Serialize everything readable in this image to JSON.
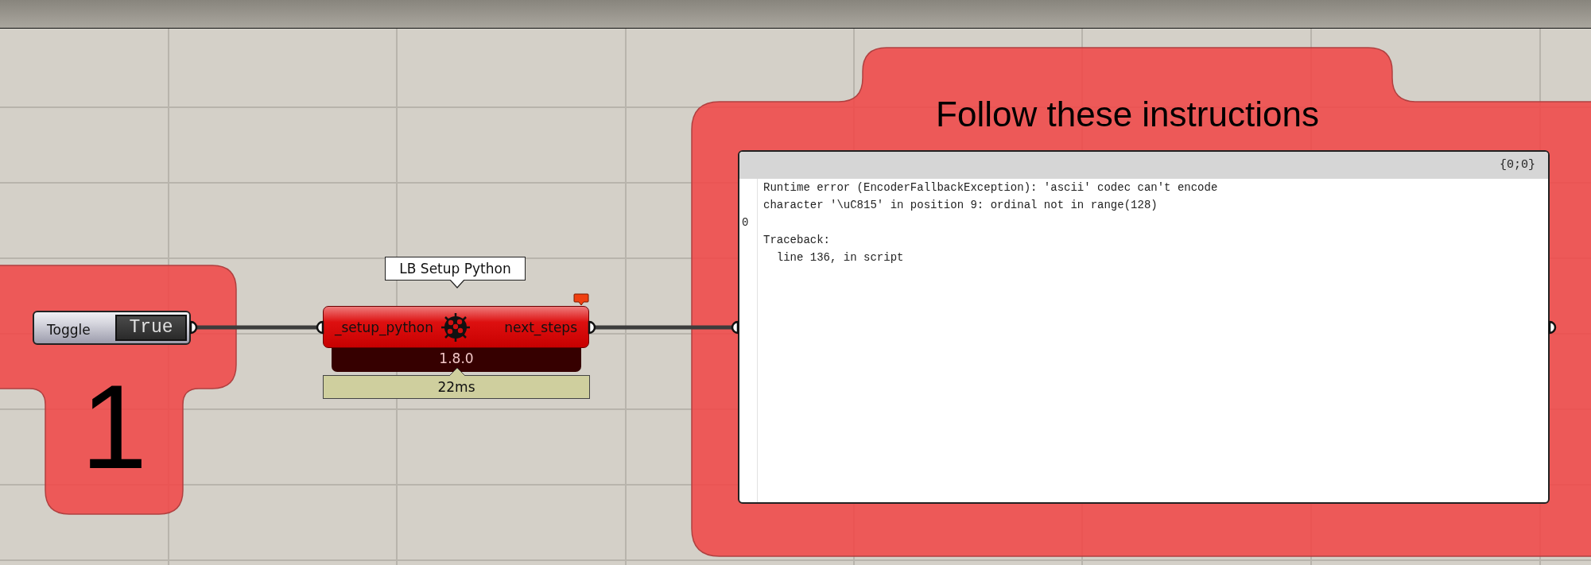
{
  "groups": [
    {
      "kind": "tee",
      "title": "1"
    },
    {
      "kind": "tab",
      "title": "Follow these instructions"
    }
  ],
  "toggle": {
    "label": "Toggle",
    "value": "True",
    "on": true
  },
  "component": {
    "tooltip": "LB Setup Python",
    "input": "_setup_python",
    "output": "next_steps",
    "version": "1.8.0",
    "timer": "22ms",
    "warning": true
  },
  "panel": {
    "header": "{0;0}",
    "rows": [
      {
        "index": "",
        "text": "Runtime error (EncoderFallbackException): 'ascii' codec can't encode"
      },
      {
        "index": "",
        "text": "character '\\uC815' in position 9: ordinal not in range(128)"
      },
      {
        "index": "0",
        "text": ""
      },
      {
        "index": "",
        "text": "Traceback:"
      },
      {
        "index": "",
        "text": "  line 136, in script"
      }
    ]
  }
}
